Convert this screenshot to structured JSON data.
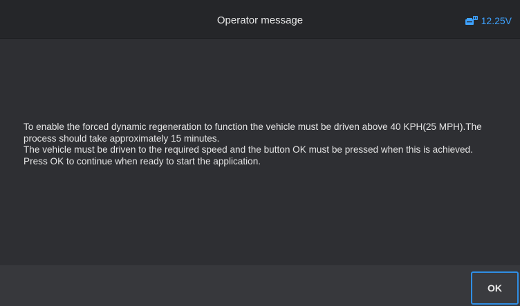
{
  "header": {
    "title": "Operator message",
    "status_icon": "vehicle-battery-icon",
    "voltage": "12.25V"
  },
  "message": {
    "lines": [
      "To enable the forced dynamic regeneration to function the vehicle must be driven above 40 KPH(25 MPH).The process should take approximately 15 minutes.",
      "The vehicle must be driven to the required speed and the button OK must be pressed when this is achieved.",
      "Press OK to continue when ready to start the application."
    ]
  },
  "footer": {
    "ok_label": "OK"
  },
  "colors": {
    "accent": "#3ea2ff",
    "header_bg": "#252629",
    "body_bg": "#2e2f33",
    "footer_bg": "#37383c"
  }
}
